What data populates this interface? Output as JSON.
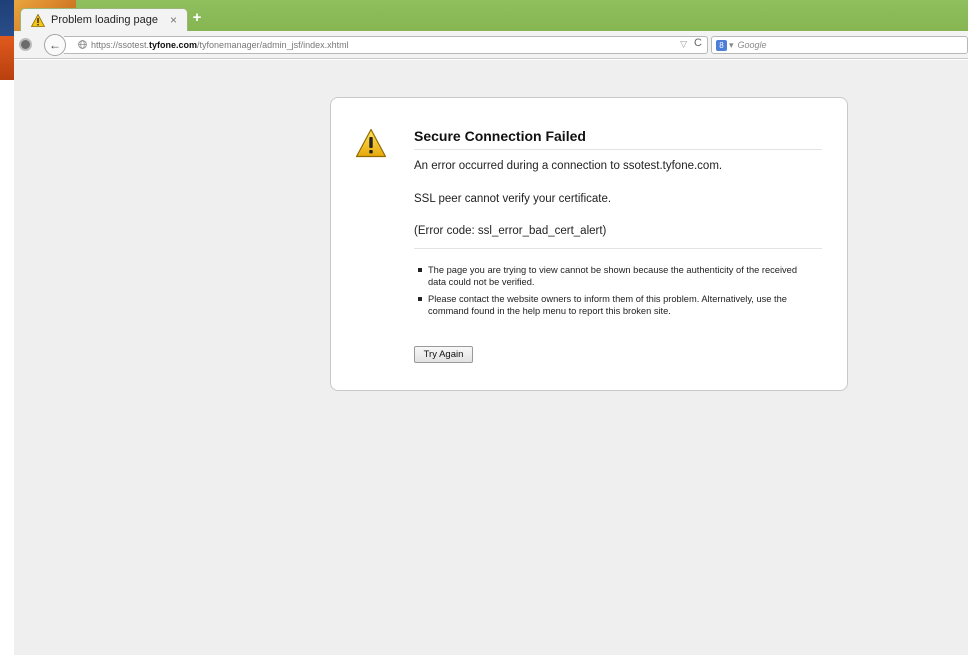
{
  "tab": {
    "title": "Problem loading page",
    "close_glyph": "×",
    "new_tab_glyph": "+"
  },
  "navbar": {
    "back_glyph": "←",
    "url_prefix": "https://ssotest.",
    "url_domain": "tyfone.com",
    "url_path": "/tyfonemanager/admin_jsf/index.xhtml",
    "url_dropmarker": "▽",
    "reload_glyph": "C",
    "search_engine_glyph": "8",
    "search_engine_caret": "▾",
    "search_placeholder": "Google"
  },
  "error": {
    "title": "Secure Connection Failed",
    "message": "An error occurred during a connection to ssotest.tyfone.com.",
    "detail": "SSL peer cannot verify your certificate.",
    "code": "(Error code: ssl_error_bad_cert_alert)",
    "bullets": [
      "The page you are trying to view cannot be shown because the authenticity of the received data could not be verified.",
      "Please contact the website owners to inform them of this problem. Alternatively, use the command found in the help menu to report this broken site."
    ],
    "try_again_label": "Try Again"
  },
  "icons": {
    "tab_icon": "warning-icon",
    "page_icon": "warning-icon",
    "menu": "firefox-menu-icon",
    "back": "back-arrow-icon",
    "site": "globe-icon",
    "reload": "reload-icon",
    "search_engine": "google-icon"
  },
  "colors": {
    "tabstrip": "#8fbf5e",
    "warning_yellow": "#f5c518",
    "content_bg": "#efefef"
  }
}
